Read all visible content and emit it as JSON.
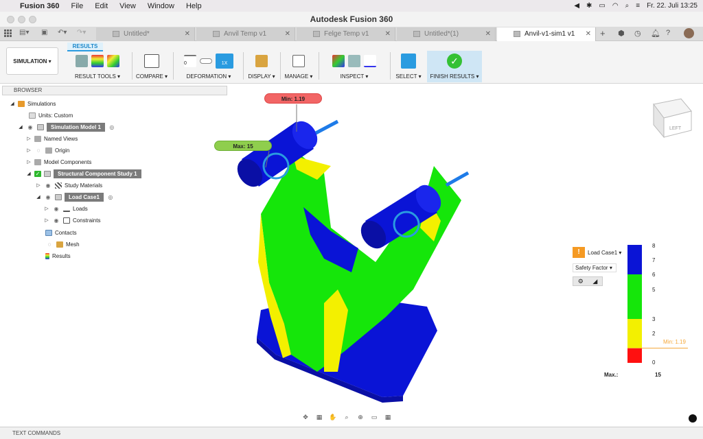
{
  "menubar": {
    "app": "Fusion 360",
    "items": [
      "File",
      "Edit",
      "View",
      "Window",
      "Help"
    ],
    "clock": "Fr. 22. Juli  13:25"
  },
  "window": {
    "title": "Autodesk Fusion 360"
  },
  "tabs": [
    {
      "label": "Untitled*"
    },
    {
      "label": "Anvil Temp v1"
    },
    {
      "label": "Felge Temp v1"
    },
    {
      "label": "Untitled*(1)"
    },
    {
      "label": "Anvil-v1-sim1 v1"
    }
  ],
  "toolbar": {
    "workspace": "SIMULATION ▾",
    "tab": "RESULTS",
    "groups": {
      "result_tools": "RESULT TOOLS ▾",
      "compare": "COMPARE ▾",
      "deformation": "DEFORMATION ▾",
      "display": "DISPLAY ▾",
      "manage": "MANAGE ▾",
      "inspect": "INSPECT ▾",
      "select": "SELECT ▾",
      "finish": "FINISH RESULTS ▾"
    },
    "deform_zero": "0",
    "deform_scale": "1X"
  },
  "browser": {
    "title": "BROWSER",
    "nodes": [
      {
        "label": "Simulations"
      },
      {
        "label": "Units: Custom"
      },
      {
        "label": "Simulation Model 1"
      },
      {
        "label": "Named Views"
      },
      {
        "label": "Origin"
      },
      {
        "label": "Model Components"
      },
      {
        "label": "Structural Component Study 1"
      },
      {
        "label": "Study Materials"
      },
      {
        "label": "Load Case1"
      },
      {
        "label": "Loads"
      },
      {
        "label": "Constraints"
      },
      {
        "label": "Contacts"
      },
      {
        "label": "Mesh"
      },
      {
        "label": "Results"
      }
    ]
  },
  "viewport": {
    "min_flag": "Min: 1.19",
    "max_flag": "Max: 15",
    "viewcube_face": "LEFT"
  },
  "legend": {
    "load_case": "Load Case1 ▾",
    "result_type": "Safety Factor",
    "ticks": [
      "8",
      "7",
      "6",
      "5",
      "3",
      "2",
      "0"
    ],
    "min_label": "Min: 1.19",
    "max_label": "Max.:",
    "max_value": "15",
    "colors": {
      "blue": "#0a14d6",
      "green": "#15e60a",
      "yellow": "#f3f000",
      "red": "#ff1010"
    }
  },
  "footer": {
    "text_commands": "TEXT COMMANDS"
  }
}
